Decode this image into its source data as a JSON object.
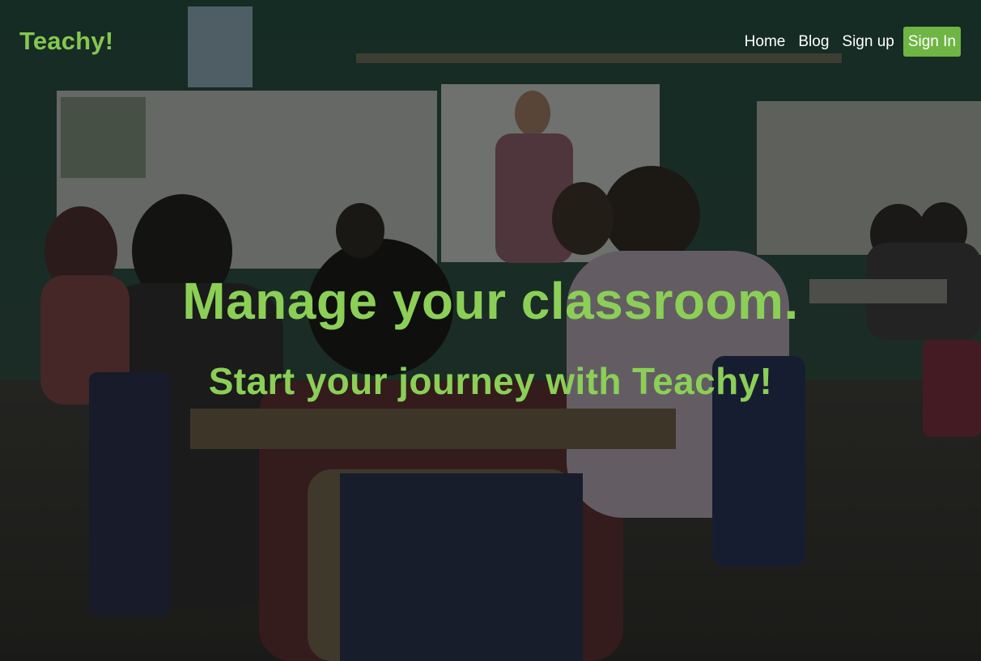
{
  "brand": {
    "name": "Teachy!"
  },
  "nav": {
    "home": "Home",
    "blog": "Blog",
    "signup": "Sign up",
    "signin": "Sign In"
  },
  "hero": {
    "title": "Manage your classroom.",
    "subtitle": "Start your journey with Teachy!"
  },
  "colors": {
    "accent": "#8bcf57",
    "button": "#6fb544",
    "nav_text": "#ffffff"
  }
}
